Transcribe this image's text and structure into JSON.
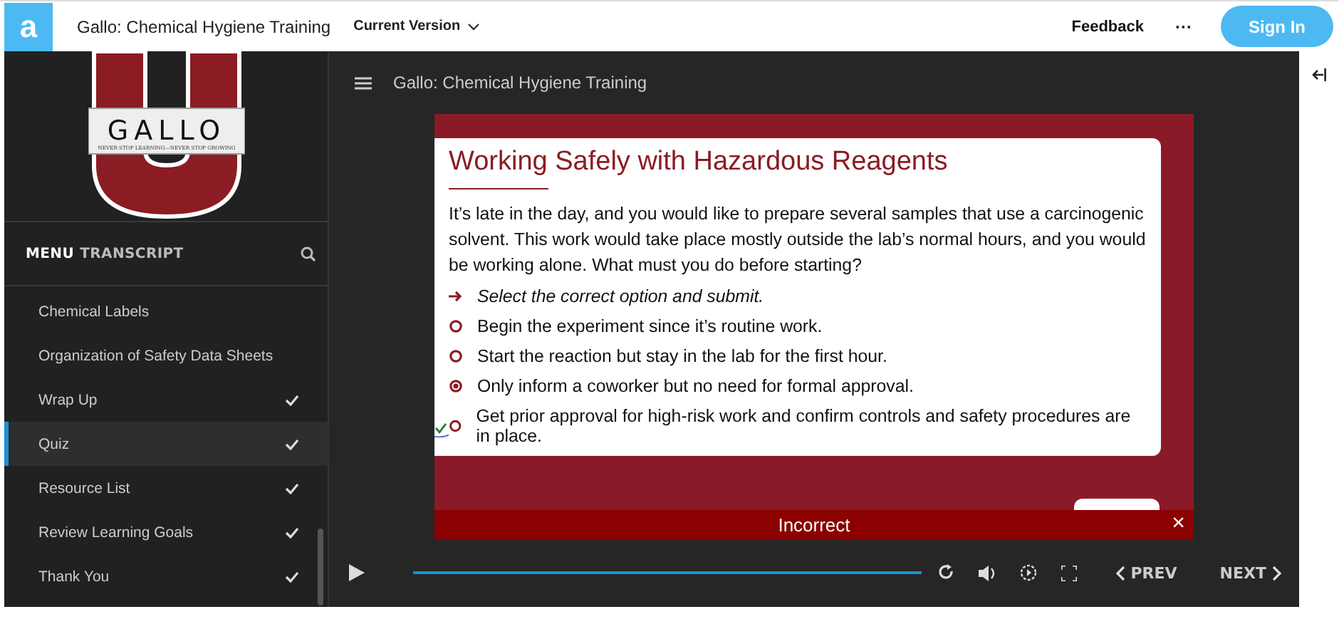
{
  "topbar": {
    "app_letter": "a",
    "title": "Gallo: Chemical Hygiene Training",
    "version": "Current Version",
    "feedback": "Feedback",
    "more": "···",
    "sign_in": "Sign In"
  },
  "logo": {
    "name": "GALLO",
    "tagline": "NEVER STOP LEARNING—NEVER STOP GROWING"
  },
  "sidebar": {
    "tabs": [
      {
        "label": "MENU",
        "selected": true
      },
      {
        "label": "TRANSCRIPT",
        "selected": false
      }
    ],
    "items": [
      {
        "label": "Chemical Labels",
        "selected": false,
        "completed": false
      },
      {
        "label": "Organization of Safety Data Sheets",
        "selected": false,
        "completed": false
      },
      {
        "label": "Wrap Up",
        "selected": false,
        "completed": true
      },
      {
        "label": "Quiz",
        "selected": true,
        "completed": true
      },
      {
        "label": "Resource List",
        "selected": false,
        "completed": true
      },
      {
        "label": "Review Learning Goals",
        "selected": false,
        "completed": true
      },
      {
        "label": "Thank You",
        "selected": false,
        "completed": true
      }
    ]
  },
  "player": {
    "title": "Gallo: Chemical Hygiene Training",
    "slide": {
      "heading": "Working Safely with Hazardous Reagents",
      "question": "It’s late in the day, and you would like to prepare several samples that use a carcinogenic solvent. This work would take place mostly outside the lab’s normal hours, and you would be working alone. What must you do before starting?",
      "instruction": "Select the correct option and submit.",
      "options": [
        {
          "label": "Begin the experiment since it’s routine work.",
          "selected": false,
          "correct": false
        },
        {
          "label": "Start the reaction but stay in the lab for the first hour.",
          "selected": false,
          "correct": false
        },
        {
          "label": "Only inform a coworker but no need for formal approval.",
          "selected": true,
          "correct": false
        },
        {
          "label": "Get prior approval for high-risk work and confirm controls and safety procedures are in place.",
          "selected": false,
          "correct": true
        }
      ],
      "feedback": "Incorrect",
      "close": "×"
    },
    "progress": {
      "level": 1
    },
    "prev": "PREV",
    "next": "NEXT"
  }
}
